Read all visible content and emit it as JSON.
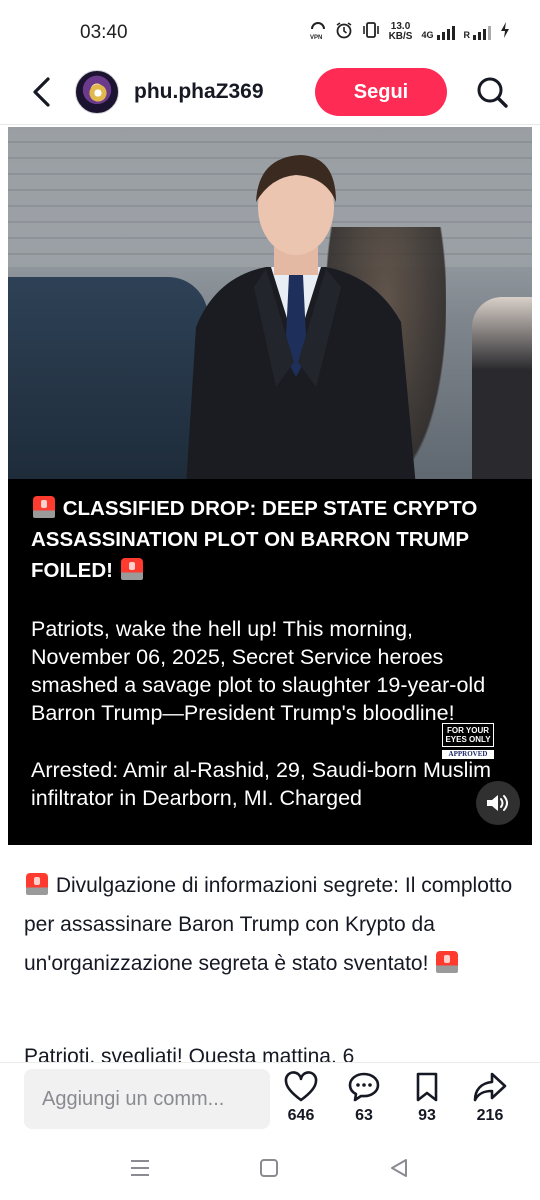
{
  "status_bar": {
    "time": "03:40",
    "speed_value": "13.0",
    "speed_unit": "KB/S",
    "network": "4G",
    "icons": [
      "vpn-icon",
      "alarm-icon",
      "vibrate-icon",
      "signal-icon",
      "signal-icon",
      "battery-charging-icon"
    ]
  },
  "header": {
    "username": "phu.phaZ369",
    "follow_label": "Segui",
    "icons": [
      "back-arrow-icon",
      "search-icon"
    ]
  },
  "post": {
    "headline": "CLASSIFIED DROP: DEEP STATE CRYPTO ASSASSINATION PLOT ON BARRON TRUMP FOILED!",
    "paragraph_1": "Patriots, wake the hell up! This morning, November 06, 2025, Secret Service heroes smashed a savage plot to slaughter 19-year-old Barron Trump—President Trump's bloodline!",
    "paragraph_2": "Arrested: Amir al-Rashid, 29, Saudi-born Muslim infiltrator in Dearborn, MI. Charged",
    "stamp_line_1": "FOR YOUR",
    "stamp_line_2": "EYES ONLY",
    "stamp_sub": "APPROVED"
  },
  "caption": {
    "text": "Divulgazione di informazioni segrete: Il complotto per assassinare Baron Trump con Krypto da un'organizzazione segreta è stato sventato!",
    "next_line": "Patrioti, svegliati! Questa mattina, 6"
  },
  "bottom_bar": {
    "comment_placeholder": "Aggiungi un comm...",
    "likes": "646",
    "comments": "63",
    "saves": "93",
    "shares": "216"
  },
  "colors": {
    "follow": "#fe2c55",
    "text": "#161823",
    "muted": "#8a8b91"
  }
}
